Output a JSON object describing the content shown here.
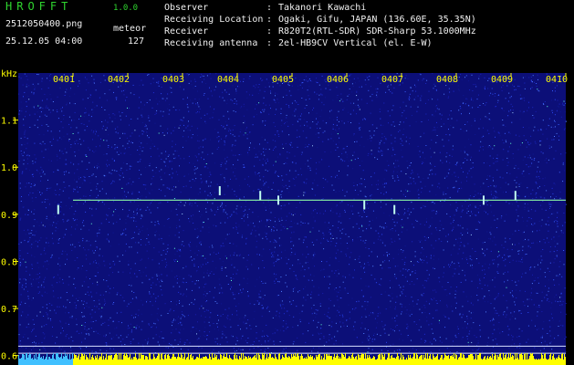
{
  "app": {
    "title": "HROFFT",
    "version": "1.0.0"
  },
  "file": {
    "name": "2512050400.png",
    "datetime": "25.12.05 04:00"
  },
  "meteor": {
    "label": "meteor",
    "count": "127"
  },
  "info": [
    {
      "label": "Observer",
      "value": "Takanori Kawachi"
    },
    {
      "label": "Receiving Location",
      "value": "Ogaki, Gifu, JAPAN (136.60E, 35.35N)"
    },
    {
      "label": "Receiver",
      "value": "R820T2(RTL-SDR) SDR-Sharp 53.1000MHz"
    },
    {
      "label": "Receiving antenna",
      "value": "2el-HB9CV Vertical (el. E-W)"
    }
  ],
  "info_separator": ":",
  "colors": {
    "header_text": "#2fd52f",
    "label_text": "#ffff00",
    "background": "#000000",
    "noise": "#1a1fb0",
    "carrier": "#7fe0a0",
    "bottom_bars": "#ffff00"
  },
  "chart_data": {
    "type": "heatmap",
    "ylabel": "kHz",
    "time_ticks": [
      "0401",
      "0402",
      "0403",
      "0404",
      "0405",
      "0406",
      "0407",
      "0408",
      "0409",
      "0410"
    ],
    "freq_ticks": [
      "1.1",
      "1.0",
      "0.9",
      "0.8",
      "0.7",
      "0.6"
    ],
    "freq_values": [
      1.1,
      1.0,
      0.9,
      0.8,
      0.7,
      0.6
    ],
    "ylim": [
      0.58,
      1.2
    ],
    "xlim_minutes": [
      0,
      10
    ],
    "carrier_freq": 0.93,
    "meteor_echoes": [
      {
        "minute": 0.73,
        "freq": 0.91
      },
      {
        "minute": 3.68,
        "freq": 0.95
      },
      {
        "minute": 4.42,
        "freq": 0.94
      },
      {
        "minute": 4.75,
        "freq": 0.93
      },
      {
        "minute": 6.32,
        "freq": 0.92
      },
      {
        "minute": 6.87,
        "freq": 0.91
      },
      {
        "minute": 8.5,
        "freq": 0.93
      },
      {
        "minute": 9.08,
        "freq": 0.94
      }
    ],
    "reference_lines": [
      0.62,
      0.605
    ],
    "grid": false
  }
}
